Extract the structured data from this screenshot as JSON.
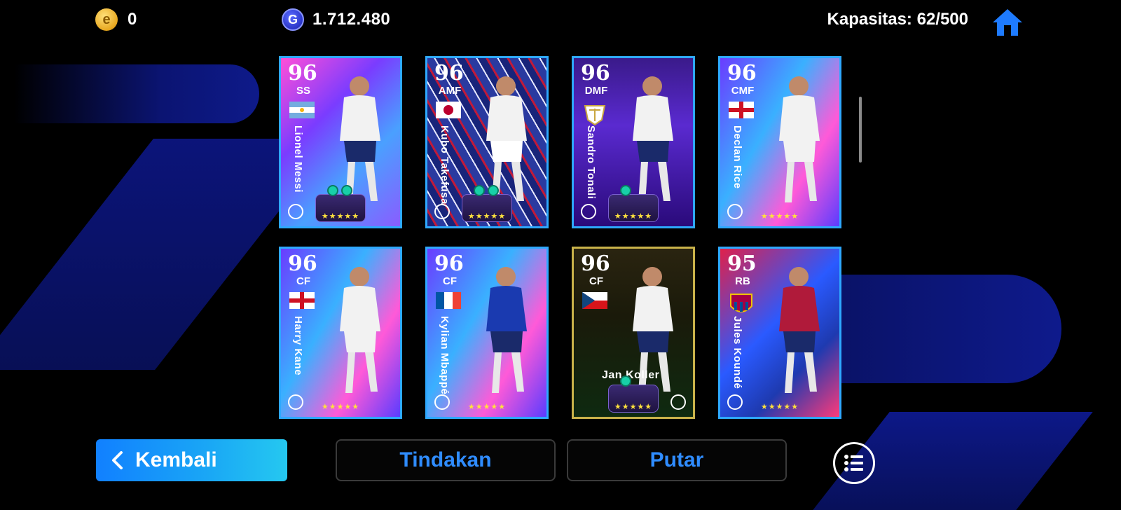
{
  "top_bar": {
    "coins": "0",
    "gp": "1.712.480",
    "capacity": "Kapasitas: 62/500",
    "coin_symbol": "e",
    "gp_symbol": "G"
  },
  "cards": [
    {
      "rating": "96",
      "position": "SS",
      "name": "Lionel Messi",
      "country": "argentina",
      "stars": "★★★★★",
      "theme": "pink-blue",
      "frame": "#2ea8ff"
    },
    {
      "rating": "96",
      "position": "AMF",
      "name": "Kubo Takefusa",
      "country": "japan",
      "stars": "★★★★★",
      "theme": "red-blue",
      "frame": "#2ea8ff"
    },
    {
      "rating": "96",
      "position": "DMF",
      "name": "Sandro Tonali",
      "country": "club-crest",
      "stars": "★★★★★",
      "theme": "purple",
      "frame": "#2ea8ff"
    },
    {
      "rating": "96",
      "position": "CMF",
      "name": "Declan Rice",
      "country": "england",
      "stars": "★★★★★",
      "theme": "cyan-purple",
      "frame": "#2ea8ff"
    },
    {
      "rating": "96",
      "position": "CF",
      "name": "Harry Kane",
      "country": "england",
      "stars": "★★★★★",
      "theme": "cyan-purple",
      "frame": "#2ea8ff"
    },
    {
      "rating": "96",
      "position": "CF",
      "name": "Kylian Mbappé",
      "country": "france",
      "stars": "★★★★★",
      "theme": "cyan-purple",
      "frame": "#2ea8ff"
    },
    {
      "rating": "96",
      "position": "CF",
      "name": "Jan Koller",
      "country": "czech",
      "stars": "★★★★★",
      "theme": "gold-green",
      "frame": "#c9b24a"
    },
    {
      "rating": "95",
      "position": "RB",
      "name": "Jules Koundé",
      "country": "barcelona",
      "stars": "★★★★★",
      "theme": "red-blue-2",
      "frame": "#2ea8ff"
    }
  ],
  "buttons": {
    "back": "Kembali",
    "actions": "Tindakan",
    "play": "Putar"
  },
  "icons": {
    "home": "home-icon",
    "menu": "list-menu-icon",
    "back": "chevron-left-icon"
  },
  "colors": {
    "accent_blue": "#2f8cff",
    "star_yellow": "#ffe23d"
  }
}
